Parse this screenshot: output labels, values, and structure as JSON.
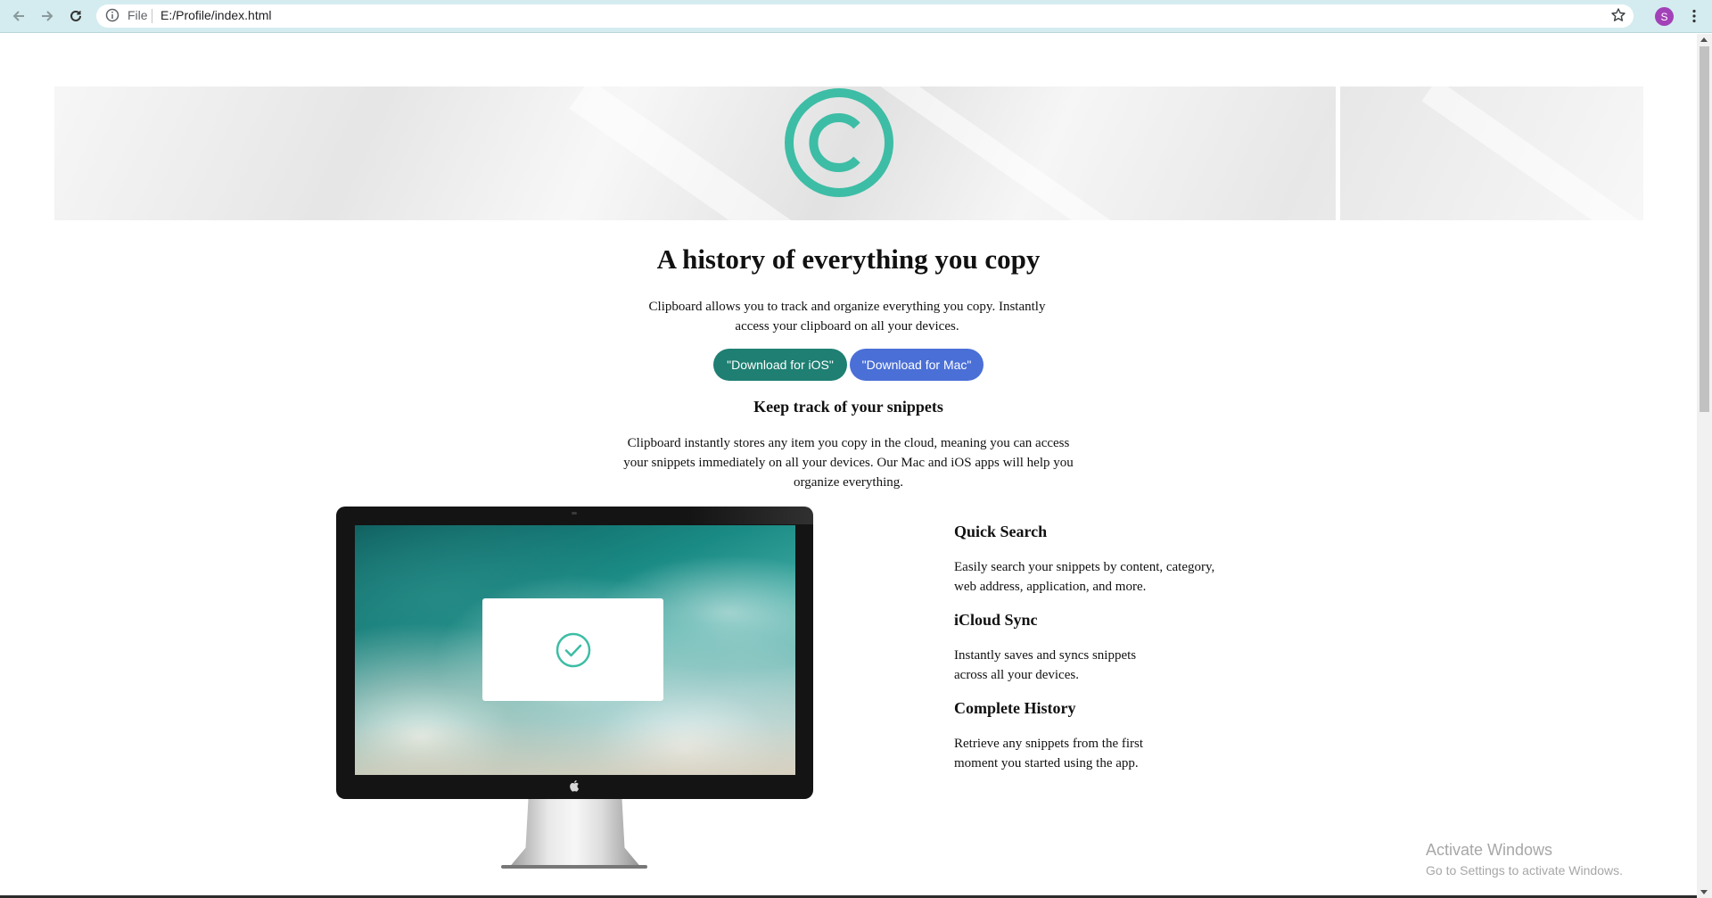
{
  "browser": {
    "scheme_label": "File",
    "url": "E:/Profile/index.html",
    "profile_initial": "S"
  },
  "hero": {
    "logo": "copyright-logo-icon",
    "accent_color": "#3dbda5"
  },
  "main": {
    "title": "A history of everything you copy",
    "lead": "Clipboard allows you to track and organize everything you copy. Instantly access your clipboard on all your devices.",
    "buttons": {
      "ios": "\"Download for iOS\"",
      "mac": "\"Download for Mac\""
    },
    "subtitle": "Keep track of your snippets",
    "description": "Clipboard instantly stores any item you copy in the cloud, meaning you can access your snippets immediately on all your devices. Our Mac and iOS apps will help you organize everything."
  },
  "features": [
    {
      "title": "Quick Search",
      "text": "Easily search your snippets by content, category, web address, application, and more."
    },
    {
      "title": "iCloud Sync",
      "text": "Instantly saves and syncs snippets across all your devices."
    },
    {
      "title": "Complete History",
      "text": "Retrieve any snippets from the first moment you started using the app."
    }
  ],
  "watermark": {
    "title": "Activate Windows",
    "subtitle": "Go to Settings to activate Windows."
  },
  "colors": {
    "ios_button": "#1e7f72",
    "mac_button": "#4a6fd6"
  }
}
